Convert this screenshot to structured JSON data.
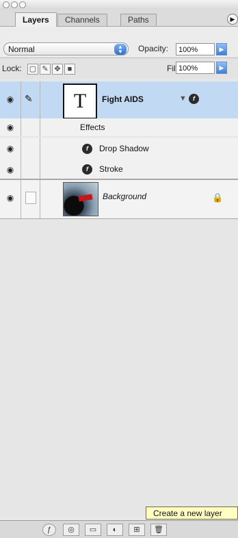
{
  "tabs": [
    "Layers",
    "Channels",
    "Paths"
  ],
  "blend": {
    "mode": "Normal",
    "opacity_label": "Opacity:",
    "opacity_value": "100%"
  },
  "lock": {
    "label": "Lock:",
    "fill_label": "Fill:",
    "fill_value": "100%"
  },
  "layers": {
    "text_layer": {
      "thumb_glyph": "T",
      "name": "Fight AIDS"
    },
    "effects_label": "Effects",
    "effect_items": [
      "Drop Shadow",
      "Stroke"
    ],
    "background_layer": {
      "name": "Background"
    }
  },
  "tooltip": "Create a new layer"
}
